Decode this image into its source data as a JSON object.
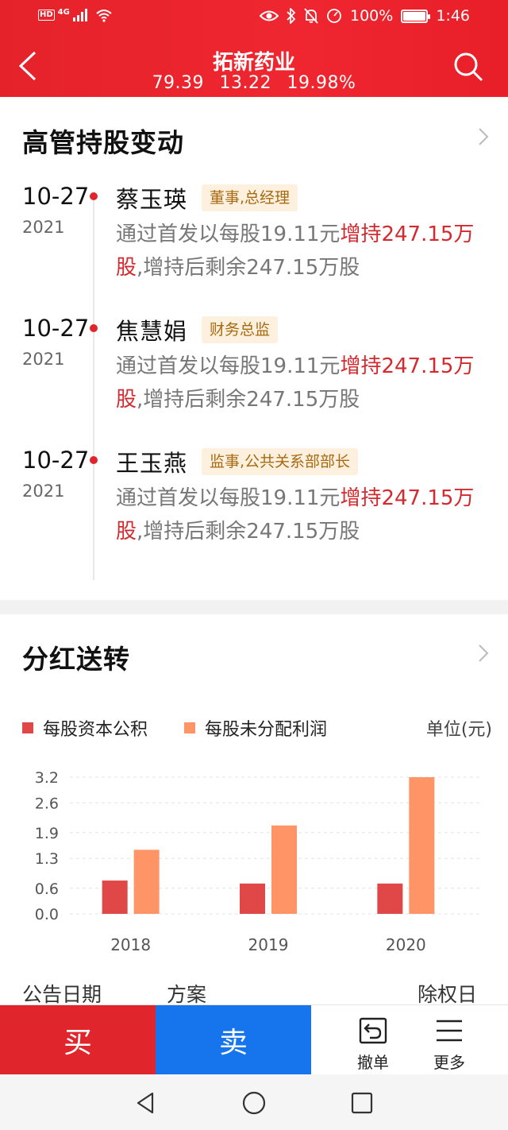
{
  "status_bar": {
    "hd": "HD",
    "network": "4G",
    "battery_pct": "100%",
    "time": "1:46"
  },
  "header": {
    "stock_name": "拓新药业",
    "price": "79.39",
    "change": "13.22",
    "change_pct": "19.98%",
    "accent_color": "#e5222a"
  },
  "executives": {
    "title": "高管持股变动",
    "entries": [
      {
        "date": "10-27",
        "year": "2021",
        "name": "蔡玉瑛",
        "role": "董事,总经理",
        "desc_pre": "通过首发以每股19.11元",
        "desc_hl": "增持247.15万股",
        "desc_post": ",增持后剩余247.15万股"
      },
      {
        "date": "10-27",
        "year": "2021",
        "name": "焦慧娟",
        "role": "财务总监",
        "desc_pre": "通过首发以每股19.11元",
        "desc_hl": "增持247.15万股",
        "desc_post": ",增持后剩余247.15万股"
      },
      {
        "date": "10-27",
        "year": "2021",
        "name": "王玉燕",
        "role": "监事,公共关系部部长",
        "desc_pre": "通过首发以每股19.11元",
        "desc_hl": "增持247.15万股",
        "desc_post": ",增持后剩余247.15万股"
      }
    ]
  },
  "dividend": {
    "title": "分红送转",
    "legend_1": "每股资本公积",
    "legend_2": "每股未分配利润",
    "unit": "单位(元)",
    "col_date": "公告日期",
    "col_plan": "方案",
    "col_exdate": "除权日"
  },
  "chart_data": {
    "type": "bar",
    "categories": [
      "2018",
      "2019",
      "2020"
    ],
    "series": [
      {
        "name": "每股资本公积",
        "values": [
          0.78,
          0.71,
          0.71
        ],
        "color": "#e04848"
      },
      {
        "name": "每股未分配利润",
        "values": [
          1.5,
          2.07,
          3.2
        ],
        "color": "#ff9466"
      }
    ],
    "y_ticks": [
      "0.0",
      "0.6",
      "1.3",
      "1.9",
      "2.6",
      "3.2"
    ],
    "ylim": [
      0,
      3.2
    ],
    "grid": true
  },
  "bottom_bar": {
    "buy": "买",
    "sell": "卖",
    "cancel": "撤单",
    "more": "更多"
  }
}
